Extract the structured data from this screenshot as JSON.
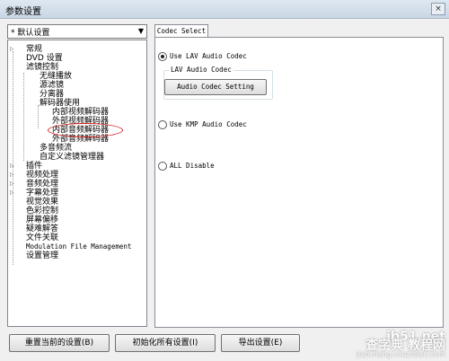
{
  "window": {
    "title": "参数设置",
    "close_glyph": "×"
  },
  "preset": {
    "value": "* 默认设置",
    "arrow": "▼"
  },
  "tree": {
    "items": [
      "常规",
      "DVD 设置",
      "滤镜控制",
      "无缝播放",
      "源滤镜",
      "分离器",
      "解码器使用",
      "内部视频解码器",
      "外部视频解码器",
      "内部音频解码器",
      "外部音频解码器",
      "多音频流",
      "自定义滤镜管理器",
      "插件",
      "视频处理",
      "音频处理",
      "字幕处理",
      "视觉效果",
      "色彩控制",
      "屏幕偏移",
      "疑难解答",
      "文件关联",
      "Modulation File Management",
      "设置管理"
    ],
    "expander": "▷"
  },
  "tab": {
    "label": "Codec Select"
  },
  "codec": {
    "use_lav": "Use LAV Audio Codec",
    "group_title": "LAV Audio Codec",
    "setting_button": "Audio Codec Setting",
    "use_kmp": "Use KMP Audio Codec",
    "all_disable": "ALL Disable"
  },
  "footer": {
    "reset_current": "重置当前的设置(B)",
    "init_all": "初始化所有设置(I)",
    "export": "导出设置(E)"
  },
  "watermark": {
    "line1": "jb51.net",
    "line2": "查字典 教程网",
    "line3": "jiaocheng.chazidian.com"
  }
}
